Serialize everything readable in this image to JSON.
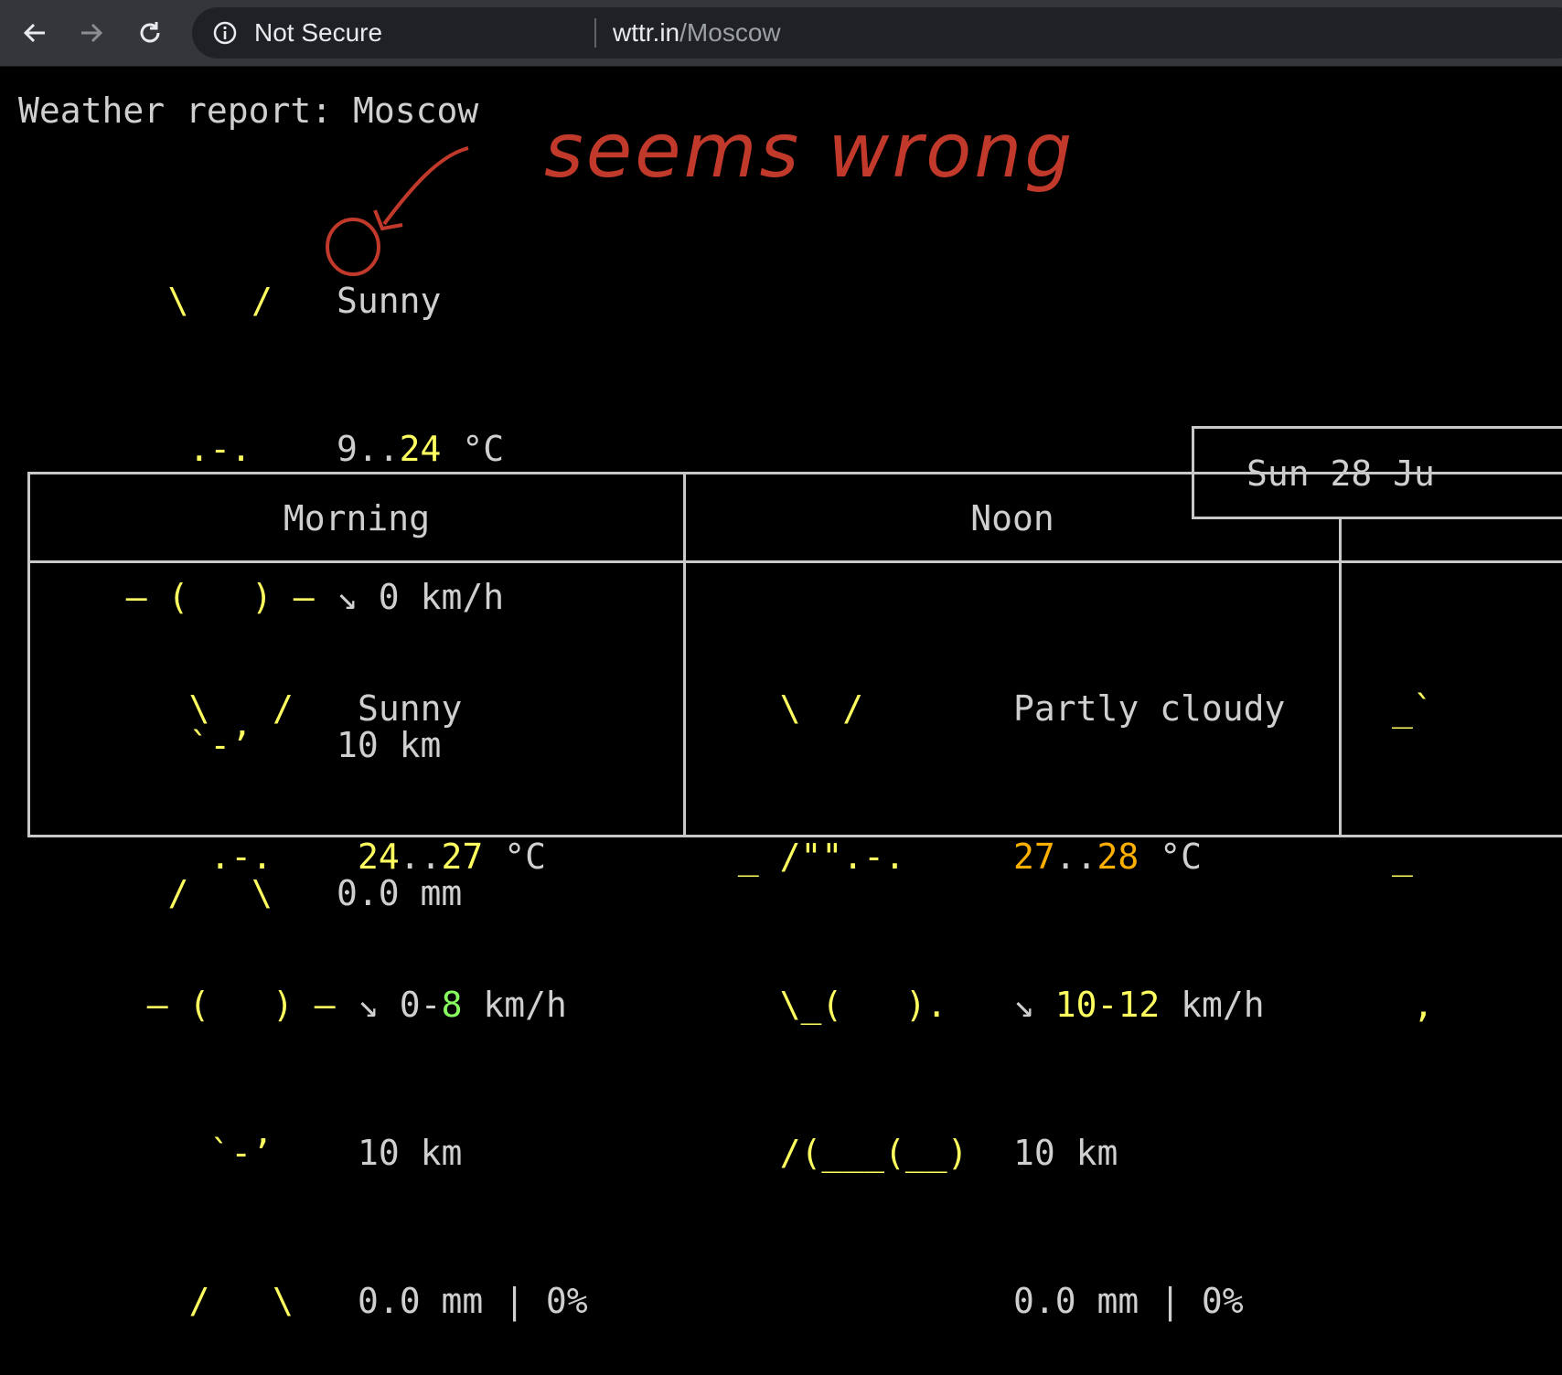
{
  "browser": {
    "security_label": "Not Secure",
    "url_domain": "wttr.in",
    "url_path": "/Moscow",
    "icons": [
      "back-arrow-icon",
      "forward-arrow-icon",
      "reload-icon",
      "info-icon"
    ]
  },
  "report": {
    "title": "Weather report: Moscow",
    "current": {
      "condition": "Sunny",
      "temp_low": "9",
      "temp_high": "24",
      "temp_unit": "°C",
      "wind_arrow": "↘",
      "wind": "0",
      "wind_unit": "km/h",
      "visibility": "10 km",
      "precip": "0.0 mm",
      "art": [
        "    \\   /    ",
        "     .-.     ",
        "  ― (   ) ―  ",
        "     `-’     ",
        "    /   \\    "
      ]
    }
  },
  "annotation": {
    "text": "seems wrong"
  },
  "forecast": {
    "date": "Sun 28 Ju",
    "periods": [
      {
        "name": "Morning",
        "condition": "Sunny",
        "temp_low": "24",
        "temp_high": "27",
        "temp_unit": "°C",
        "wind_arrow": "↘",
        "wind_low": "0",
        "wind_high": "8",
        "wind_unit": "km/h",
        "visibility": "10 km",
        "precip": "0.0 mm",
        "chance": "0%",
        "art": [
          "    \\   /    ",
          "     .-.     ",
          "  ― (   ) ―  ",
          "     `-’     ",
          "    /   \\    "
        ]
      },
      {
        "name": "Noon",
        "condition": "Partly cloudy",
        "temp_low": "27",
        "temp_high": "28",
        "temp_unit": "°C",
        "wind_arrow": "↘",
        "wind_low": "10",
        "wind_high": "12",
        "wind_unit": "km/h",
        "visibility": "10 km",
        "precip": "0.0 mm",
        "chance": "0%",
        "art": [
          "   \\  /      ",
          " _ /\"\".-.    ",
          "   \\_(   ).  ",
          "   /(___(__) ",
          "             "
        ]
      }
    ],
    "partial_art": [
      "_`",
      "_",
      " ,"
    ]
  },
  "colors": {
    "sun": "#ffff5f",
    "wind_low": "#87ff5f",
    "temp_warm": "#ffaf00",
    "annotation": "#c0392b"
  }
}
